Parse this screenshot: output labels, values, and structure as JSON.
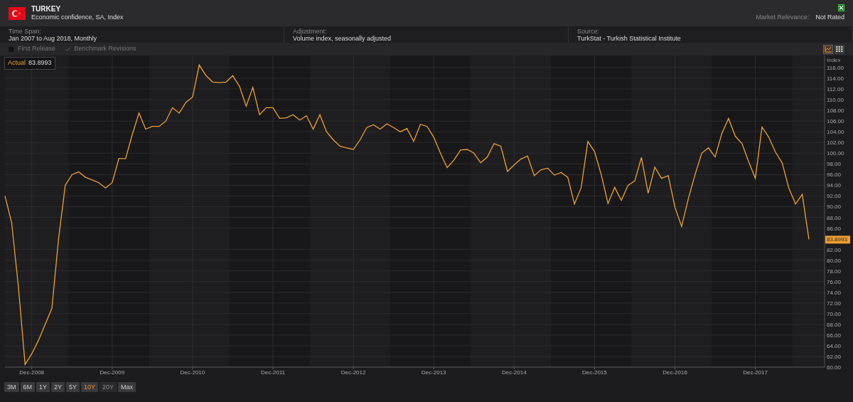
{
  "header": {
    "country": "TURKEY",
    "indicator": "Economic confidence, SA, Index",
    "market_relevance_label": "Market Relevance:",
    "market_relevance_value": "Not Rated"
  },
  "info": [
    {
      "label": "Time Span:",
      "value": "Jan 2007 to Aug 2018, Monthly"
    },
    {
      "label": "Adjustment:",
      "value": "Volume index, seasonally adjusted"
    },
    {
      "label": "Source:",
      "value": "TurkStat - Turkish Statistical Institute"
    }
  ],
  "options": [
    {
      "label": "First Release",
      "checked": false
    },
    {
      "label": "Benchmark Revisions",
      "checked": true
    }
  ],
  "view_toggle": [
    {
      "kind": "chart",
      "selected": true
    },
    {
      "kind": "table",
      "selected": false
    }
  ],
  "legend": {
    "value": "83.8993"
  },
  "chart": {
    "chart_data": {
      "type": "line",
      "ylabel": "Index",
      "categories": [
        null,
        null,
        null,
        null,
        "Dec-2008",
        null,
        null,
        null,
        null,
        null,
        null,
        null,
        null,
        null,
        null,
        null,
        "Dec-2009",
        null,
        null,
        null,
        null,
        null,
        null,
        null,
        null,
        null,
        null,
        null,
        "Dec-2010",
        null,
        null,
        null,
        null,
        null,
        null,
        null,
        null,
        null,
        null,
        null,
        "Dec-2011",
        null,
        null,
        null,
        null,
        null,
        null,
        null,
        null,
        null,
        null,
        null,
        "Dec-2012",
        null,
        null,
        null,
        null,
        null,
        null,
        null,
        null,
        null,
        null,
        null,
        "Dec-2013",
        null,
        null,
        null,
        null,
        null,
        null,
        null,
        null,
        null,
        null,
        null,
        "Dec-2014",
        null,
        null,
        null,
        null,
        null,
        null,
        null,
        null,
        null,
        null,
        null,
        "Dec-2015",
        null,
        null,
        null,
        null,
        null,
        null,
        null,
        null,
        null,
        null,
        null,
        "Dec-2016",
        null,
        null,
        null,
        null,
        null,
        null,
        null,
        null,
        null,
        null,
        null,
        "Dec-2017",
        null,
        null,
        null,
        null,
        null,
        null,
        null,
        null
      ],
      "grid": true,
      "series": [
        {
          "name": "Actual",
          "color": "#f0a030",
          "values": [
            92,
            87,
            75,
            60.5,
            62.5,
            65,
            68,
            71,
            84,
            94,
            96,
            96.5,
            95.5,
            95,
            94.5,
            93.5,
            94.5,
            99,
            99,
            103.5,
            107.5,
            104.5,
            105,
            105,
            106,
            108.5,
            107.5,
            109.5,
            110.5,
            116.5,
            114.5,
            113.3,
            113.2,
            113.3,
            114.5,
            112.5,
            108.8,
            112.3,
            107.2,
            108.5,
            108.5,
            106.5,
            106.6,
            107.2,
            106.2,
            107,
            104.5,
            107.2,
            104,
            102.5,
            101.3,
            101,
            100.7,
            102.5,
            104.8,
            105.3,
            104.5,
            105.5,
            104.8,
            104,
            104.6,
            102.2,
            105.4,
            105,
            103,
            100,
            97.3,
            98.7,
            100.6,
            100.7,
            100,
            98.2,
            99.3,
            101.8,
            101.3,
            96.6,
            97.8,
            98.9,
            99.5,
            95.8,
            96.9,
            97.2,
            95.9,
            96.4,
            95.5,
            90.5,
            93.5,
            102.2,
            100.3,
            96,
            90.6,
            93.6,
            91.2,
            94,
            94.8,
            99.2,
            92.5,
            97.4,
            95.3,
            95.8,
            89.9,
            86.3,
            91.5,
            96,
            100,
            101,
            99.3,
            103.7,
            106.5,
            103.2,
            101.8,
            98.4,
            95.3,
            104.9,
            103,
            100.2,
            98.2,
            93.5,
            90.5,
            92.3,
            83.9
          ]
        }
      ],
      "yticks": [
        {
          "value": 60,
          "label": "60.00"
        },
        {
          "value": 62,
          "label": "62.00"
        },
        {
          "value": 64,
          "label": "64.00"
        },
        {
          "value": 66,
          "label": "66.00"
        },
        {
          "value": 68,
          "label": "68.00"
        },
        {
          "value": 70,
          "label": "70.00"
        },
        {
          "value": 72,
          "label": "72.00"
        },
        {
          "value": 74,
          "label": "74.00"
        },
        {
          "value": 76,
          "label": "76.00"
        },
        {
          "value": 78,
          "label": "78.00"
        },
        {
          "value": 80,
          "label": "80.00"
        },
        {
          "value": 82,
          "label": "82.00"
        },
        {
          "value": 86,
          "label": "86.00"
        },
        {
          "value": 88,
          "label": "88.00"
        },
        {
          "value": 90,
          "label": "90.00"
        },
        {
          "value": 92,
          "label": "92.00"
        },
        {
          "value": 94,
          "label": "94.00"
        },
        {
          "value": 96,
          "label": "96.00"
        },
        {
          "value": 98,
          "label": "98.00"
        },
        {
          "value": 100,
          "label": "100.00"
        },
        {
          "value": 102,
          "label": "102.00"
        },
        {
          "value": 104,
          "label": "104.00"
        },
        {
          "value": 106,
          "label": "106.00"
        },
        {
          "value": 108,
          "label": "108.00"
        },
        {
          "value": 110,
          "label": "110.00"
        },
        {
          "value": 112,
          "label": "112.00"
        },
        {
          "value": 114,
          "label": "114.00"
        },
        {
          "value": 116,
          "label": "116.00"
        }
      ],
      "ylim": [
        60,
        118
      ]
    },
    "last_value_label": "83.8993"
  },
  "ranges": [
    {
      "label": "3M",
      "selected": false,
      "disabled": false
    },
    {
      "label": "6M",
      "selected": false,
      "disabled": false
    },
    {
      "label": "1Y",
      "selected": false,
      "disabled": false
    },
    {
      "label": "2Y",
      "selected": false,
      "disabled": false
    },
    {
      "label": "5Y",
      "selected": false,
      "disabled": false
    },
    {
      "label": "10Y",
      "selected": true,
      "disabled": false
    },
    {
      "label": "20Y",
      "selected": false,
      "disabled": true
    },
    {
      "label": "Max",
      "selected": false,
      "disabled": false
    }
  ]
}
